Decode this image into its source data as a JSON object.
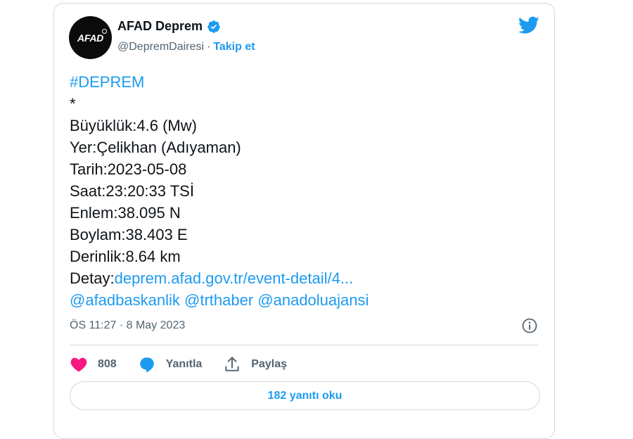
{
  "author": {
    "avatar_text": "AFAD",
    "name": "AFAD Deprem",
    "handle": "@DepremDairesi",
    "separator": "·",
    "follow_label": "Takip et"
  },
  "tweet": {
    "hashtag": "#DEPREM",
    "star": "*",
    "magnitude": "Büyüklük:4.6 (Mw)",
    "location": "Yer:Çelikhan (Adıyaman)",
    "date": "Tarih:2023-05-08",
    "time": "Saat:23:20:33 TSİ",
    "latitude": "Enlem:38.095 N",
    "longitude": "Boylam:38.403 E",
    "depth": "Derinlik:8.64 km",
    "detail_prefix": "Detay:",
    "detail_link": "deprem.afad.gov.tr/event-detail/4...",
    "mention_1": "@afadbaskanlik",
    "mention_2": "@trthaber",
    "mention_3": "@anadoluajansi"
  },
  "timestamp": "ÖS 11:27 · 8 May 2023",
  "actions": {
    "like_count": "808",
    "reply_label": "Yanıtla",
    "share_label": "Paylaş"
  },
  "read_replies_label": "182 yanıtı oku",
  "colors": {
    "accent": "#1d9bf0",
    "like": "#f91880",
    "text": "#0f1419",
    "secondary": "#536471",
    "border": "#cfd9de"
  },
  "icons": [
    "verified-badge-icon",
    "twitter-bird-icon",
    "info-icon",
    "heart-icon",
    "reply-bubble-icon",
    "share-icon"
  ]
}
